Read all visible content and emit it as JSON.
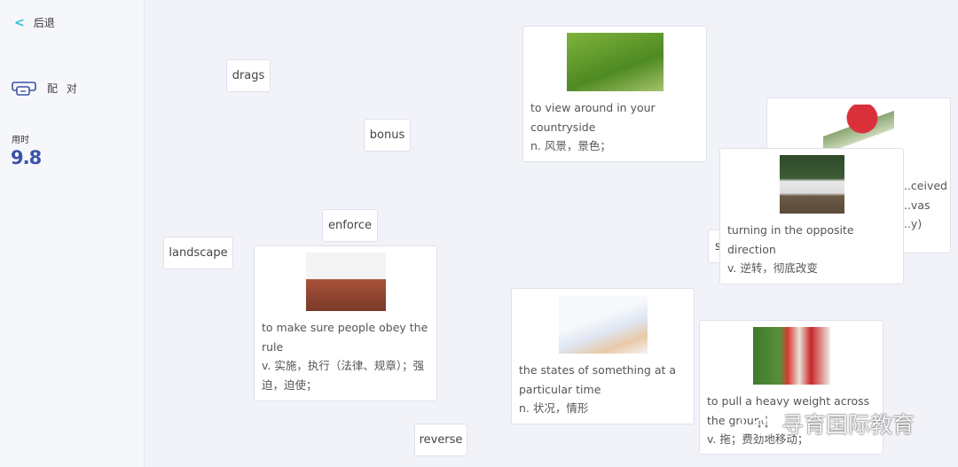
{
  "sidebar": {
    "back_label": "后退",
    "mode_label": "配 对",
    "time_label": "用时",
    "time_value": "9.8"
  },
  "terms": [
    "drags",
    "bonus",
    "enforce",
    "landscape",
    "reverse",
    "s"
  ],
  "cards": {
    "landscape": {
      "en": "to view around in your countryside",
      "zh": "n. 风景，景色；"
    },
    "bonus": {
      "en": "...ceived ...vas ...y)"
    },
    "reverse": {
      "en": "turning in the opposite direction",
      "zh": "v. 逆转，彻底改变"
    },
    "enforce": {
      "en": "to make sure people obey the rule",
      "zh": "v. 实施，执行（法律、规章）；强迫，迫使；"
    },
    "status": {
      "en": "the states of something at a particular time",
      "zh": "n. 状况，情形"
    },
    "drag": {
      "en": "to pull a heavy weight across the ground",
      "zh": "v. 拖；费劲地移动；"
    }
  },
  "watermark": "寻育国际教育",
  "colors": {
    "accent": "#2bc3d4",
    "timer": "#3a53a8"
  }
}
